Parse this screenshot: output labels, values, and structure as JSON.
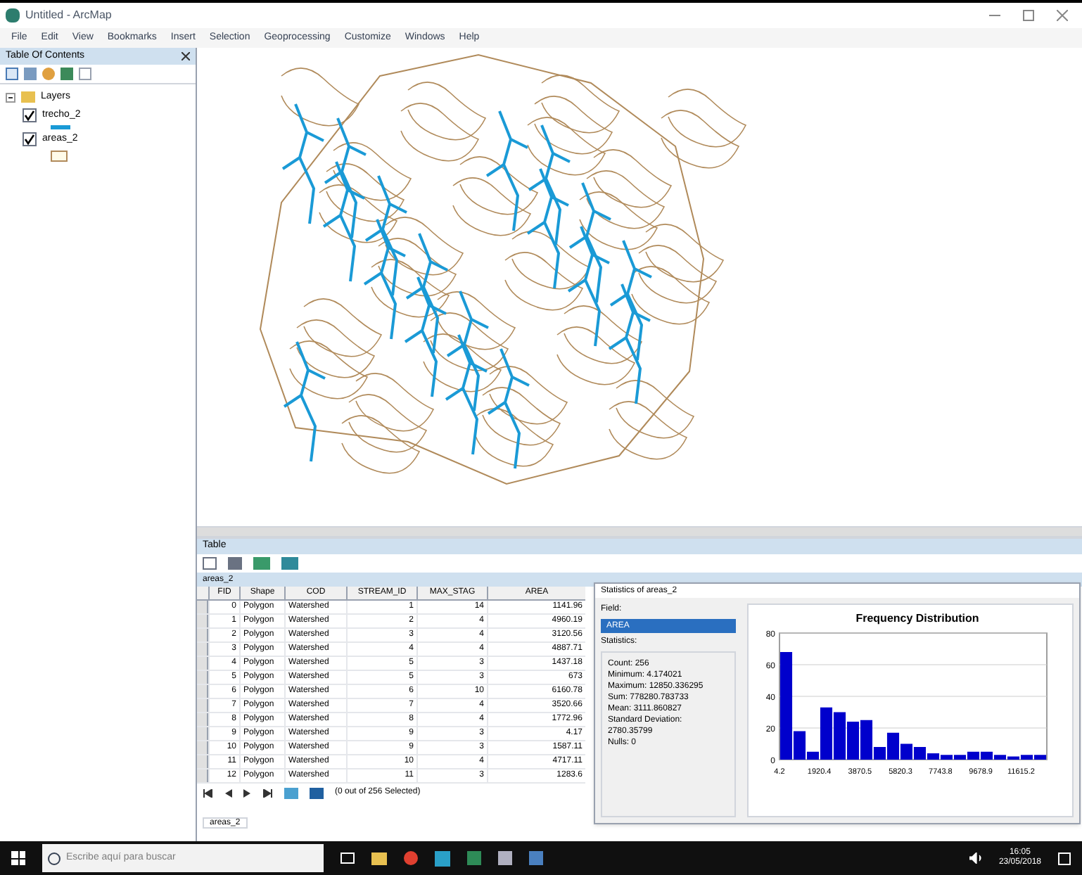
{
  "window": {
    "title": "Untitled - ArcMap"
  },
  "menu": [
    "File",
    "Edit",
    "View",
    "Bookmarks",
    "Insert",
    "Selection",
    "Geoprocessing",
    "Customize",
    "Windows",
    "Help"
  ],
  "toc": {
    "title": "Table Of Contents",
    "root": {
      "label": "Layers",
      "expanded": true,
      "children": [
        {
          "label": "trecho_2",
          "kind": "line",
          "checked": true
        },
        {
          "label": "areas_2",
          "kind": "polygon",
          "checked": true
        }
      ]
    }
  },
  "table": {
    "title": "Table",
    "tab": "areas_2",
    "columns": [
      "FID",
      "Shape",
      "COD",
      "STREAM_ID",
      "MAX_STAG",
      "AREA"
    ],
    "rows": [
      [
        "0",
        "Polygon",
        "Watershed",
        "1",
        "14",
        "1141.96"
      ],
      [
        "1",
        "Polygon",
        "Watershed",
        "2",
        "4",
        "4960.19"
      ],
      [
        "2",
        "Polygon",
        "Watershed",
        "3",
        "4",
        "3120.56"
      ],
      [
        "3",
        "Polygon",
        "Watershed",
        "4",
        "4",
        "4887.71"
      ],
      [
        "4",
        "Polygon",
        "Watershed",
        "5",
        "3",
        "1437.18"
      ],
      [
        "5",
        "Polygon",
        "Watershed",
        "5",
        "3",
        "673"
      ],
      [
        "6",
        "Polygon",
        "Watershed",
        "6",
        "10",
        "6160.78"
      ],
      [
        "7",
        "Polygon",
        "Watershed",
        "7",
        "4",
        "3520.66"
      ],
      [
        "8",
        "Polygon",
        "Watershed",
        "8",
        "4",
        "1772.96"
      ],
      [
        "9",
        "Polygon",
        "Watershed",
        "9",
        "3",
        "4.17"
      ],
      [
        "10",
        "Polygon",
        "Watershed",
        "9",
        "3",
        "1587.11"
      ],
      [
        "11",
        "Polygon",
        "Watershed",
        "10",
        "4",
        "4717.11"
      ],
      [
        "12",
        "Polygon",
        "Watershed",
        "11",
        "3",
        "1283.6"
      ]
    ],
    "footer": "(0 out of 256 Selected)",
    "layer_tab": "areas_2"
  },
  "stats": {
    "title": "Statistics of areas_2",
    "field_label": "Field:",
    "field_value": "AREA",
    "stats_label": "Statistics:",
    "lines": [
      "Count: 256",
      "Minimum: 4.174021",
      "Maximum: 12850.336295",
      "Sum: 778280.783733",
      "Mean: 3111.860827",
      "Standard Deviation: 2780.35799",
      "Nulls: 0"
    ],
    "chart_data": {
      "type": "bar",
      "title": "Frequency Distribution",
      "grid": true,
      "x": [
        325.4,
        967.7,
        1610,
        2252.3,
        2894.6,
        3536.9,
        4179.2,
        4821.5,
        5463.8,
        6106.1,
        6748.4,
        7390.7,
        8033,
        8675.3,
        9317.6,
        9959.9,
        10602.2,
        11244.5,
        11886.8,
        12529.1
      ],
      "xlim": [
        4.2,
        12850.3
      ],
      "series": [
        {
          "color": "#0000cc",
          "values": [
            68,
            18,
            5,
            33,
            30,
            24,
            25,
            8,
            17,
            10,
            8,
            4,
            3,
            3,
            5,
            5,
            3,
            2,
            3,
            3
          ]
        }
      ],
      "ylim": [
        0,
        80
      ],
      "yticks": [
        0,
        20,
        40,
        60,
        80
      ],
      "xticks": [
        {
          "value": 4.2,
          "label": "4.2"
        },
        {
          "value": 1920.4,
          "label": "1920.4"
        },
        {
          "value": 3870.5,
          "label": "3870.5"
        },
        {
          "value": 5820.3,
          "label": "5820.3"
        },
        {
          "value": 7743.8,
          "label": "7743.8"
        },
        {
          "value": 9678.9,
          "label": "9678.9"
        },
        {
          "value": 11615.2,
          "label": "11615.2"
        }
      ]
    }
  },
  "taskbar": {
    "search_placeholder": "Escribe aquí para buscar",
    "time": "16:05",
    "date": "23/05/2018"
  }
}
